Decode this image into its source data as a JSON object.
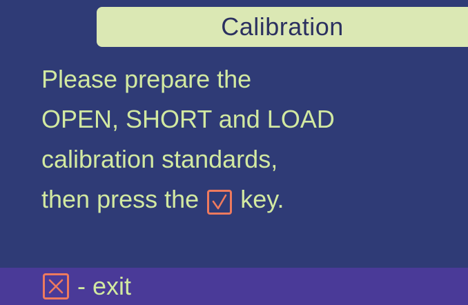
{
  "header": {
    "title": "Calibration"
  },
  "message": {
    "line1": "Please prepare the",
    "line2": "OPEN, SHORT and LOAD",
    "line3": "calibration standards,",
    "line4_before": "then press the",
    "line4_after": "key.",
    "confirm_key_icon": "check-key-icon"
  },
  "footer": {
    "exit_key_icon": "cross-key-icon",
    "exit_label": "- exit"
  },
  "colors": {
    "background": "#2f3b76",
    "title_bar": "#dbe8b4",
    "title_text": "#2b3060",
    "text": "#d2e9a1",
    "footer_bar": "#4a3a98",
    "key_accent": "#ee7a5e"
  }
}
